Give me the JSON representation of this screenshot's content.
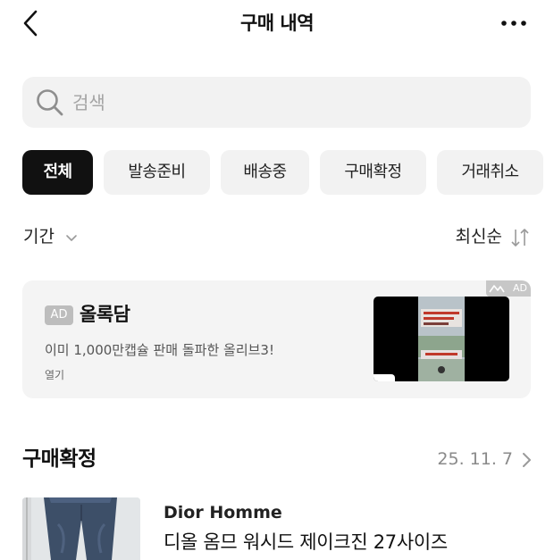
{
  "header": {
    "title": "구매 내역"
  },
  "search": {
    "placeholder": "검색",
    "value": ""
  },
  "filters": [
    {
      "label": "전체",
      "active": true
    },
    {
      "label": "발송준비",
      "active": false
    },
    {
      "label": "배송중",
      "active": false
    },
    {
      "label": "구매확정",
      "active": false
    },
    {
      "label": "거래취소",
      "active": false
    }
  ],
  "period": {
    "label": "기간"
  },
  "sort": {
    "label": "최신순"
  },
  "ad": {
    "badge": "AD",
    "brand": "올록담",
    "description": "이미 1,000만캡슐 판매 돌파한 올리브3!",
    "open_label": "열기",
    "corner_label": "AD"
  },
  "section": {
    "title": "구매확정",
    "date": "25. 11. 7"
  },
  "product": {
    "brand": "Dior Homme",
    "name": "디올 옴므 워시드 제이크진 27사이즈"
  },
  "colors": {
    "chip_active_bg": "#111111",
    "chip_bg": "#f2f2f2",
    "muted": "#8a8a8a"
  }
}
